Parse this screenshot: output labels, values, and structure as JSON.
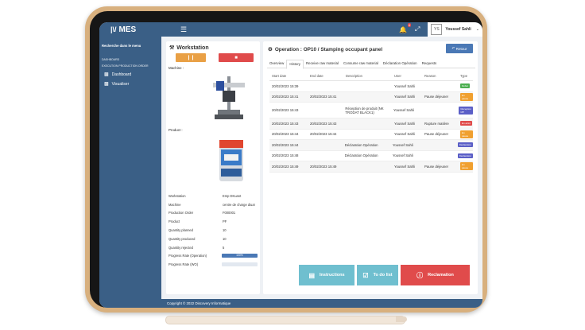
{
  "app": {
    "logo_mark": "|\\/",
    "logo_text": "MES"
  },
  "topbar": {
    "notification_count": "4",
    "avatar_initials": "YS",
    "user_name": "Youssef Sahli"
  },
  "sidebar": {
    "search_label": "Recherche dans le menu",
    "section_dashboard": "DASHBOARD",
    "section_execution": "EXECUTION PRODUCTION ORDER",
    "items": [
      {
        "label": "Dashboard"
      },
      {
        "label": "Visualiser"
      }
    ]
  },
  "workstation": {
    "title": "Workstation",
    "machine_label": "Machine :",
    "product_label": "Product :",
    "info": [
      {
        "key": "Workstation",
        "value": "Emp DKuant"
      },
      {
        "key": "Machine",
        "value": "centre de charge diuar"
      },
      {
        "key": "Production Order",
        "value": "F000001"
      },
      {
        "key": "Product",
        "value": "PF"
      },
      {
        "key": "Quantity planned",
        "value": "10"
      },
      {
        "key": "Quantity produced",
        "value": "10"
      },
      {
        "key": "Quantity rejected",
        "value": "5"
      }
    ],
    "progress_operation_label": "Progress Rate (Operation)",
    "progress_operation_value": "100%",
    "progress_operation_fraction": 1.0,
    "progress_wo_label": "Progress Rate (WO)",
    "progress_wo_fraction": 0.0
  },
  "operation": {
    "title": "Operation : OP10 / Stamping occupant panel",
    "return_label": "Retour",
    "tabs": [
      "Overview",
      "History",
      "Receive raw material",
      "Consume raw material",
      "Déclaration Opération",
      "Requests"
    ],
    "active_tab": 1,
    "columns": [
      "Start date",
      "End date",
      "Description",
      "User",
      "Reason",
      "Type"
    ],
    "rows": [
      {
        "start": "20/02/2023 15:39",
        "end": "",
        "desc": "",
        "user": "Youssef Sahli",
        "reason": "",
        "type": "Début",
        "color": "#4caf50"
      },
      {
        "start": "20/02/2023 15:41",
        "end": "20/02/2023 15:41",
        "desc": "",
        "user": "Youssef Sahli",
        "reason": "Pause déjeuner",
        "type": "En pause",
        "color": "#f0a030"
      },
      {
        "start": "20/02/2023 15:43",
        "end": "",
        "desc": "Réception de produit (NK TRODAT BLACK1)",
        "user": "Youssef Sahli",
        "reason": "",
        "type": "Réception MP",
        "color": "#5b5fc7"
      },
      {
        "start": "20/02/2023 15:43",
        "end": "20/02/2023 15:43",
        "desc": "",
        "user": "Youssef Sahli",
        "reason": "Rupture matière",
        "type": "En arrêt",
        "color": "#e04b4b"
      },
      {
        "start": "20/02/2023 15:44",
        "end": "20/02/2023 15:44",
        "desc": "",
        "user": "Youssef Sahli",
        "reason": "Pause déjeuner",
        "type": "En pause",
        "color": "#f0a030"
      },
      {
        "start": "20/02/2023 15:44",
        "end": "",
        "desc": "Déclaration Opération",
        "user": "Youssef Sahli",
        "reason": "",
        "type": "Déclaration",
        "color": "#5b5fc7"
      },
      {
        "start": "20/02/2023 15:48",
        "end": "",
        "desc": "Déclaration Opération",
        "user": "Youssef Sahli",
        "reason": "",
        "type": "Déclaration",
        "color": "#5b5fc7"
      },
      {
        "start": "20/02/2023 15:49",
        "end": "20/02/2023 15:49",
        "desc": "",
        "user": "Youssef Sahli",
        "reason": "Pause déjeuner",
        "type": "En pause",
        "color": "#f0a030"
      }
    ],
    "actions": [
      {
        "label": "Instructions",
        "color": "#6fbfcf"
      },
      {
        "label": "To do list",
        "color": "#6fbfcf"
      },
      {
        "label": "Reclamation",
        "color": "#e04b4b"
      }
    ]
  },
  "footer": {
    "text": "Copyright © 2022 Discovery Informatique"
  }
}
